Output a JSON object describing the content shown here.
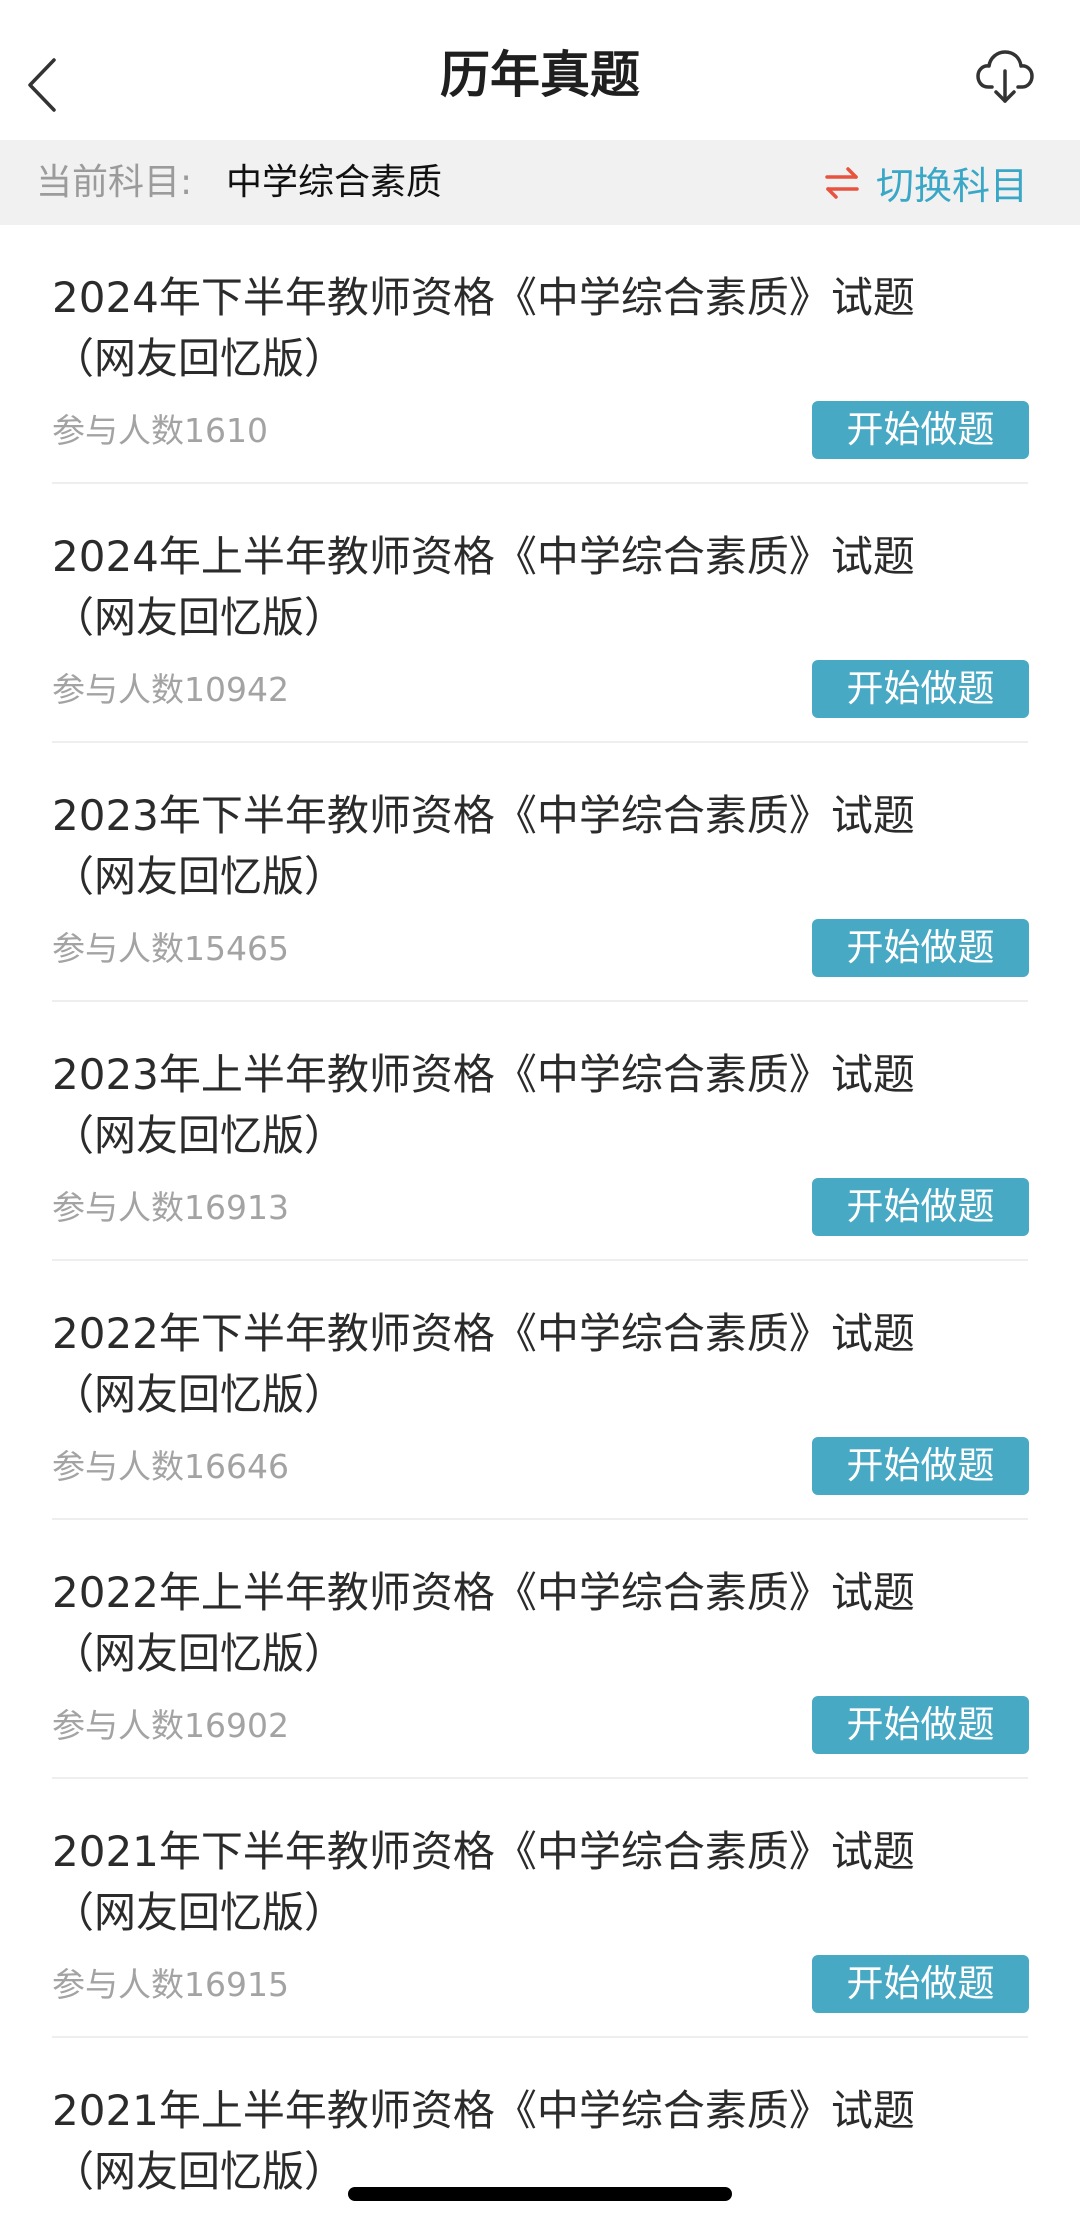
{
  "header": {
    "title": "历年真题",
    "back_icon": "chevron-left-icon",
    "download_icon": "cloud-download-icon"
  },
  "subject_bar": {
    "label": "当前科目:",
    "value": "中学综合素质",
    "switch_icon": "swap-arrows-icon",
    "switch_label": "切换科目"
  },
  "colors": {
    "accent": "#48a9c5",
    "switch_text": "#3aa7c6",
    "switch_icon": "#e8533f",
    "subject_bar_bg": "#f1f1f1"
  },
  "items": [
    {
      "title": "2024年下半年教师资格《中学综合素质》试题（网友回忆版）",
      "count": "参与人数1610",
      "button": "开始做题"
    },
    {
      "title": "2024年上半年教师资格《中学综合素质》试题（网友回忆版）",
      "count": "参与人数10942",
      "button": "开始做题"
    },
    {
      "title": "2023年下半年教师资格《中学综合素质》试题（网友回忆版）",
      "count": "参与人数15465",
      "button": "开始做题"
    },
    {
      "title": "2023年上半年教师资格《中学综合素质》试题（网友回忆版）",
      "count": "参与人数16913",
      "button": "开始做题"
    },
    {
      "title": "2022年下半年教师资格《中学综合素质》试题（网友回忆版）",
      "count": "参与人数16646",
      "button": "开始做题"
    },
    {
      "title": "2022年上半年教师资格《中学综合素质》试题（网友回忆版）",
      "count": "参与人数16902",
      "button": "开始做题"
    },
    {
      "title": "2021年下半年教师资格《中学综合素质》试题（网友回忆版）",
      "count": "参与人数16915",
      "button": "开始做题"
    },
    {
      "title": "2021年上半年教师资格《中学综合素质》试题（网友回忆版）",
      "count": "",
      "button": ""
    }
  ]
}
